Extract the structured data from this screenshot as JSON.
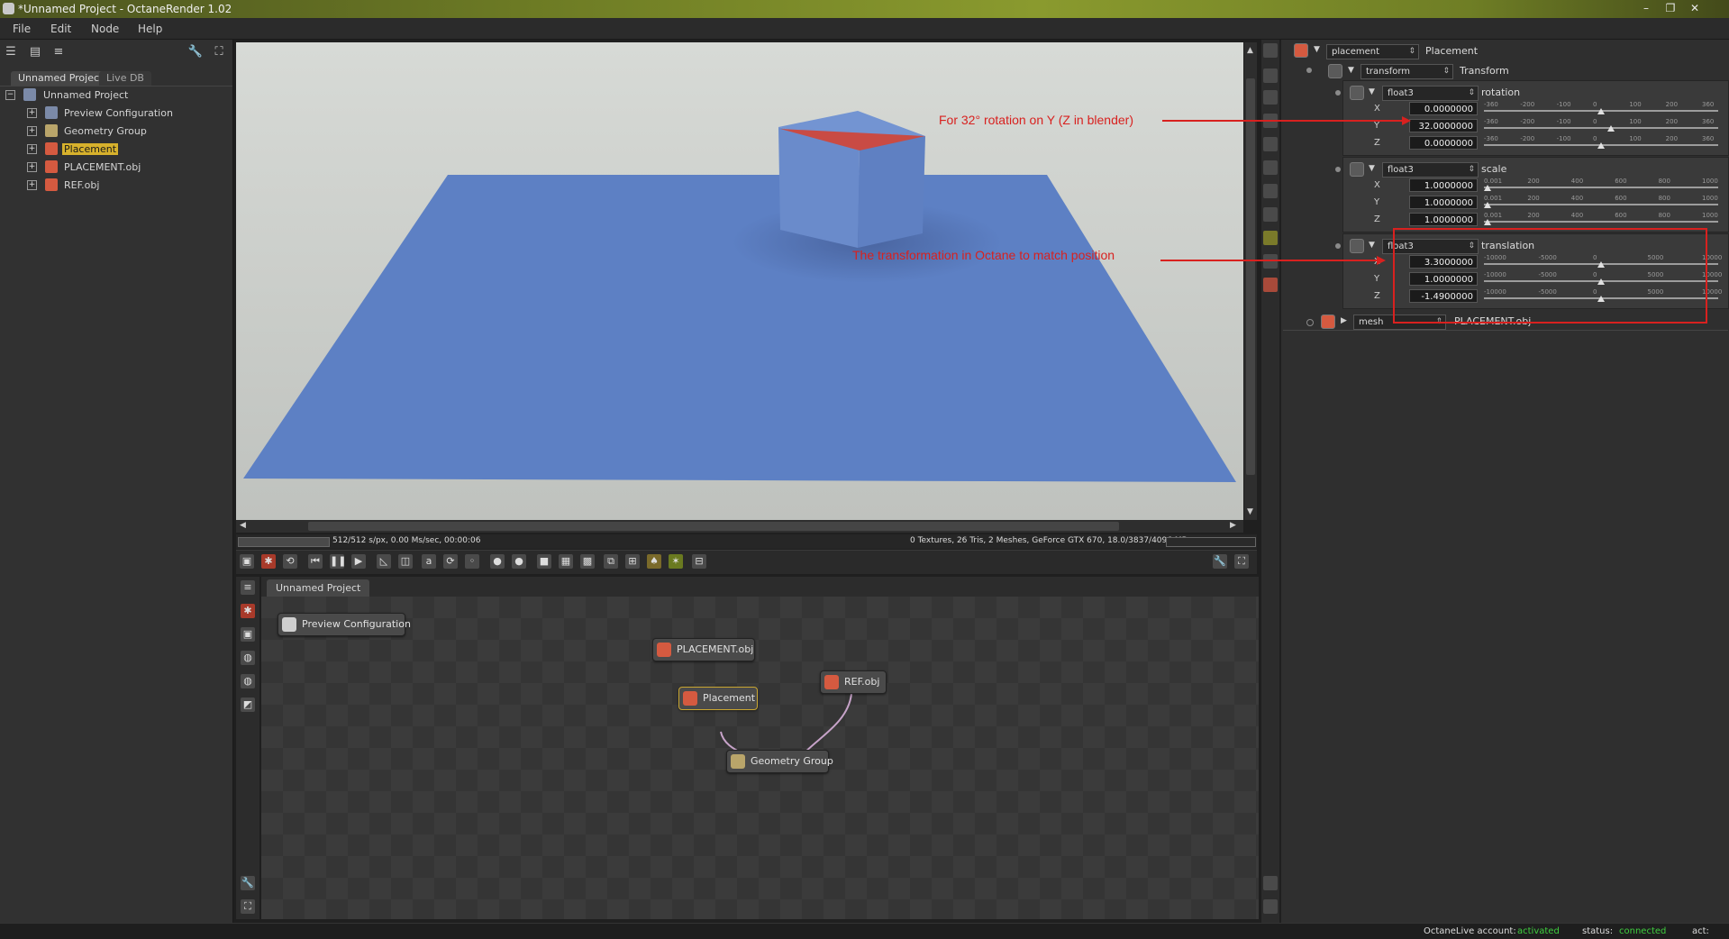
{
  "window": {
    "title": "*Unnamed Project - OctaneRender 1.02",
    "controls": [
      "minimize-icon",
      "maximize-icon",
      "close-icon"
    ]
  },
  "menu": [
    "File",
    "Edit",
    "Node",
    "Help"
  ],
  "left_panel": {
    "tabs": [
      "Unnamed Project",
      "Live DB"
    ],
    "tree": {
      "root": "Unnamed Project",
      "items": [
        "Preview Configuration",
        "Geometry Group",
        "Placement",
        "PLACEMENT.obj",
        "REF.obj"
      ],
      "selected": "Placement"
    }
  },
  "viewport": {
    "status_left": "512/512 s/px, 0.00 Ms/sec, 00:00:06",
    "status_right": "0 Textures, 26 Tris, 2 Meshes, GeForce GTX 670, 18.0/3837/4096 MB",
    "colors": {
      "background": "#c9ccc9",
      "plane": "#5b7fc4",
      "cube": "#6e8fcf",
      "cube_top": "#c94b44"
    }
  },
  "annotations": {
    "rotation_note": "For 32° rotation on Y (Z in blender)",
    "translation_note": "The transformation in Octane to match position",
    "color": "#d8211f"
  },
  "node_graph": {
    "tab": "Unnamed Project",
    "nodes": {
      "preview": "Preview Configuration",
      "placement_obj": "PLACEMENT.obj",
      "placement": "Placement",
      "ref_obj": "REF.obj",
      "geometry_group": "Geometry Group"
    }
  },
  "inspector": {
    "header": {
      "type": "placement",
      "name": "Placement"
    },
    "transform": {
      "type": "transform",
      "name": "Transform"
    },
    "rotation": {
      "type": "float3",
      "name": "rotation",
      "x": "0.0000000",
      "y": "32.0000000",
      "z": "0.0000000",
      "ticks": [
        "-360",
        "-200",
        "-100",
        "0",
        "100",
        "200",
        "360"
      ],
      "x_level": 0.5,
      "y_level": 0.544,
      "z_level": 0.5
    },
    "scale": {
      "type": "float3",
      "name": "scale",
      "x": "1.0000000",
      "y": "1.0000000",
      "z": "1.0000000",
      "ticks": [
        "0.001",
        "200",
        "400",
        "600",
        "800",
        "1000"
      ],
      "x_level": 0.001,
      "y_level": 0.001,
      "z_level": 0.001
    },
    "translation": {
      "type": "float3",
      "name": "translation",
      "x": "3.3000000",
      "y": "1.0000000",
      "z": "-1.4900000",
      "ticks": [
        "-10000",
        "-5000",
        "0",
        "5000",
        "10000"
      ],
      "x_level": 0.5,
      "y_level": 0.5,
      "z_level": 0.5
    },
    "mesh": {
      "type": "mesh",
      "name": "PLACEMENT.obj"
    },
    "axes": [
      "X",
      "Y",
      "Z"
    ]
  },
  "bottom_status": {
    "account_label": "OctaneLive account:",
    "account_value": "activated",
    "status_label": "status:",
    "status_value": "connected",
    "act_label": "act:",
    "ok_color": "#3fcf3f"
  }
}
